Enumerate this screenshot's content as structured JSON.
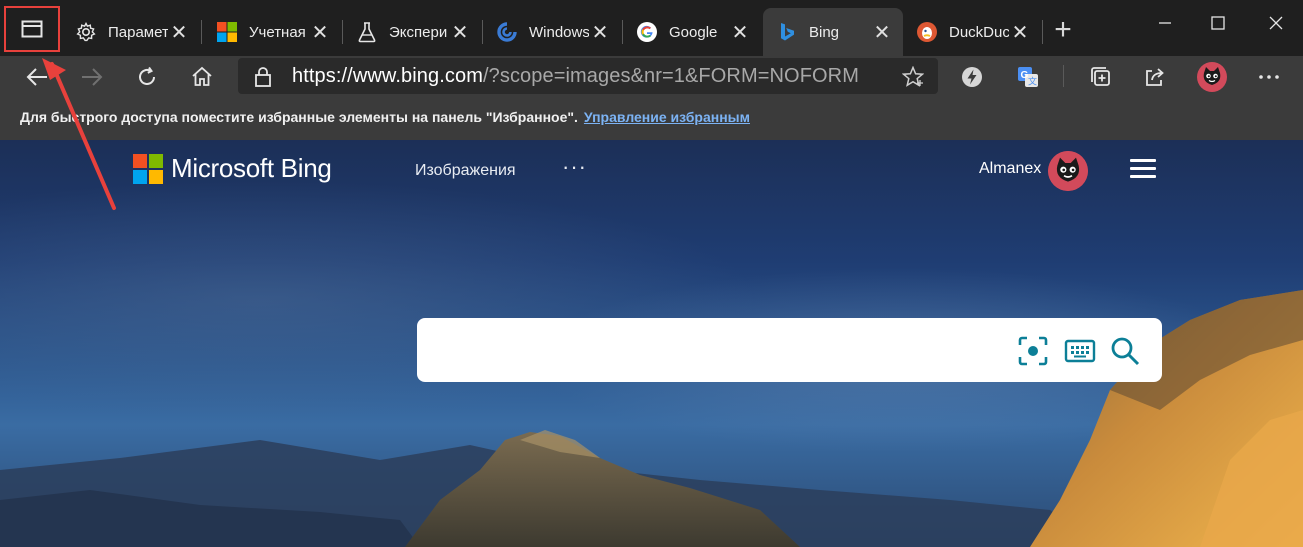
{
  "tabs": [
    {
      "title": "Парамет",
      "icon": "gear-icon"
    },
    {
      "title": "Учетная",
      "icon": "microsoft-logo-icon"
    },
    {
      "title": "Экспери",
      "icon": "flask-icon"
    },
    {
      "title": "Windows",
      "icon": "windows-site-icon"
    },
    {
      "title": "Google",
      "icon": "google-icon"
    },
    {
      "title": "Bing",
      "icon": "bing-icon",
      "active": true
    },
    {
      "title": "DuckDuc",
      "icon": "duckduckgo-icon"
    }
  ],
  "tab_close_glyph": "✕",
  "new_tab_glyph": "+",
  "address": {
    "host": "https://www.bing.com",
    "path": "/?scope=images&nr=1&FORM=NOFORM"
  },
  "favorites_bar": {
    "message": "Для быстрого доступа поместите избранные элементы на панель \"Избранное\".",
    "link": "Управление избранным"
  },
  "bing": {
    "logo_text": "Microsoft Bing",
    "nav_images": "Изображения",
    "nav_more": "···",
    "user_name": "Almanex",
    "search_placeholder": ""
  },
  "colors": {
    "highlight_red": "#e8413c",
    "link_blue": "#7cb3f4",
    "bing_teal": "#0c7f97"
  }
}
